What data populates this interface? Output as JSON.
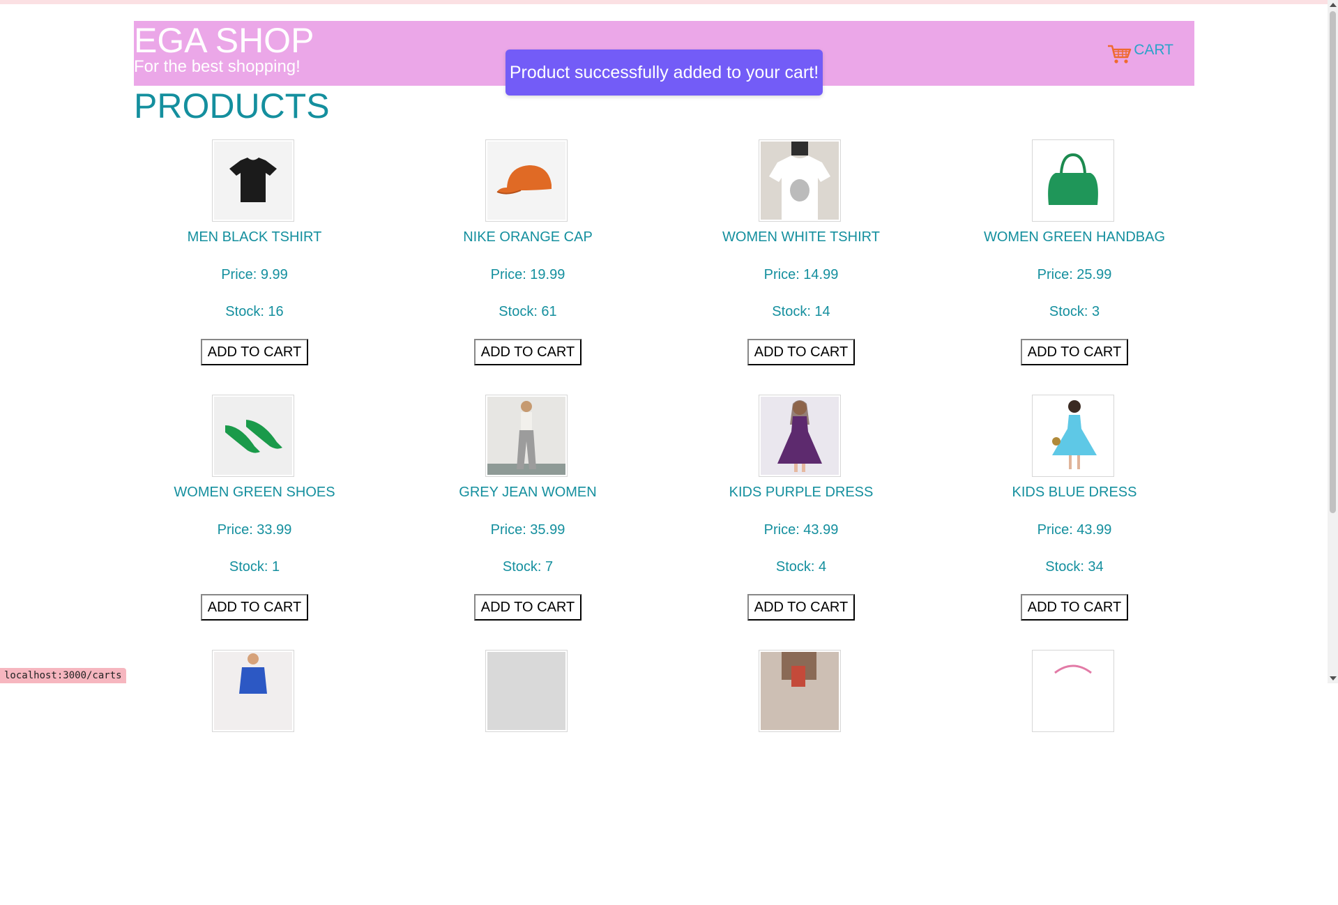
{
  "header": {
    "title": "EGA SHOP",
    "subtitle": "For the best shopping!",
    "cart_label": "CART",
    "bg_color": "#eba7e8"
  },
  "toast": {
    "message": "Product successfully added to your cart!",
    "color": "#735cf7"
  },
  "main": {
    "title": "PRODUCTS",
    "add_label": "ADD TO CART",
    "products": [
      {
        "name": "MEN BLACK TSHIRT",
        "price": "Price: 9.99",
        "stock": "Stock: 16",
        "image_icon": "black-tshirt-image"
      },
      {
        "name": "NIKE ORANGE CAP",
        "price": "Price: 19.99",
        "stock": "Stock: 61",
        "image_icon": "orange-cap-image"
      },
      {
        "name": "WOMEN WHITE TSHIRT",
        "price": "Price: 14.99",
        "stock": "Stock: 14",
        "image_icon": "white-tshirt-image"
      },
      {
        "name": "WOMEN GREEN HANDBAG",
        "price": "Price: 25.99",
        "stock": "Stock: 3",
        "image_icon": "green-handbag-image"
      },
      {
        "name": "WOMEN GREEN SHOES",
        "price": "Price: 33.99",
        "stock": "Stock: 1",
        "image_icon": "green-shoes-image"
      },
      {
        "name": "GREY JEAN WOMEN",
        "price": "Price: 35.99",
        "stock": "Stock: 7",
        "image_icon": "grey-jean-image"
      },
      {
        "name": "KIDS PURPLE DRESS",
        "price": "Price: 43.99",
        "stock": "Stock: 4",
        "image_icon": "purple-dress-image"
      },
      {
        "name": "KIDS BLUE DRESS",
        "price": "Price: 43.99",
        "stock": "Stock: 34",
        "image_icon": "blue-dress-image"
      }
    ]
  },
  "status_bar": {
    "url": "localhost:3000/carts"
  }
}
